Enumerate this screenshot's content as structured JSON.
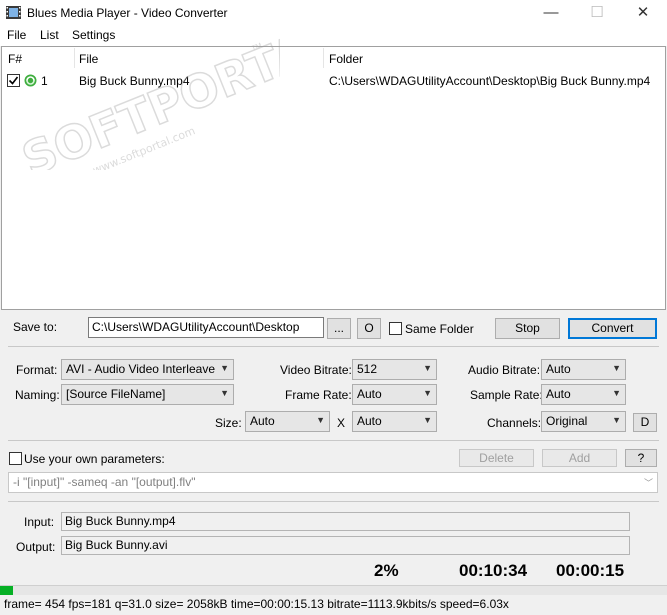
{
  "window": {
    "title": "Blues Media Player - Video Converter",
    "minimize": "—",
    "maximize": "☐",
    "close": "✕"
  },
  "menu": {
    "file": "File",
    "list": "List",
    "settings": "Settings"
  },
  "list": {
    "headers": {
      "num": "F#",
      "file": "File",
      "folder": "Folder"
    },
    "rows": [
      {
        "num": "1",
        "file": "Big Buck Bunny.mp4",
        "folder": "C:\\Users\\WDAGUtilityAccount\\Desktop\\Big Buck Bunny.mp4",
        "checked": true
      }
    ]
  },
  "save": {
    "label": "Save to:",
    "path": "C:\\Users\\WDAGUtilityAccount\\Desktop",
    "browse": "...",
    "open": "O",
    "same_folder": "Same Folder",
    "stop": "Stop",
    "convert": "Convert"
  },
  "options": {
    "format_label": "Format:",
    "format_value": "AVI - Audio Video Interleave",
    "naming_label": "Naming:",
    "naming_value": "[Source FileName]",
    "size_label": "Size:",
    "size_w": "Auto",
    "size_x": "X",
    "size_h": "Auto",
    "video_bitrate_label": "Video Bitrate:",
    "video_bitrate": "512",
    "frame_rate_label": "Frame Rate:",
    "frame_rate": "Auto",
    "audio_bitrate_label": "Audio Bitrate:",
    "audio_bitrate": "Auto",
    "sample_rate_label": "Sample Rate:",
    "sample_rate": "Auto",
    "channels_label": "Channels:",
    "channels": "Original",
    "d_button": "D"
  },
  "params": {
    "label": "Use your own parameters:",
    "delete": "Delete",
    "add": "Add",
    "help": "?",
    "value": "-i \"[input]\" -sameq -an \"[output].flv\""
  },
  "io": {
    "input_label": "Input:",
    "input": "Big Buck Bunny.mp4",
    "output_label": "Output:",
    "output": "Big Buck Bunny.avi"
  },
  "progress": {
    "percent_text": "2%",
    "elapsed": "00:10:34",
    "remaining": "00:00:15",
    "fraction": 0.02
  },
  "status": "frame=  454 fps=181 q=31.0 size=     2058kB time=00:00:15.13 bitrate=1113.9kbits/s speed=6.03x",
  "watermark": {
    "text": "SOFTPORTAL",
    "tm": "™",
    "url": "www.softportal.com"
  },
  "colors": {
    "progress": "#06b025",
    "accent": "#0078d7"
  }
}
